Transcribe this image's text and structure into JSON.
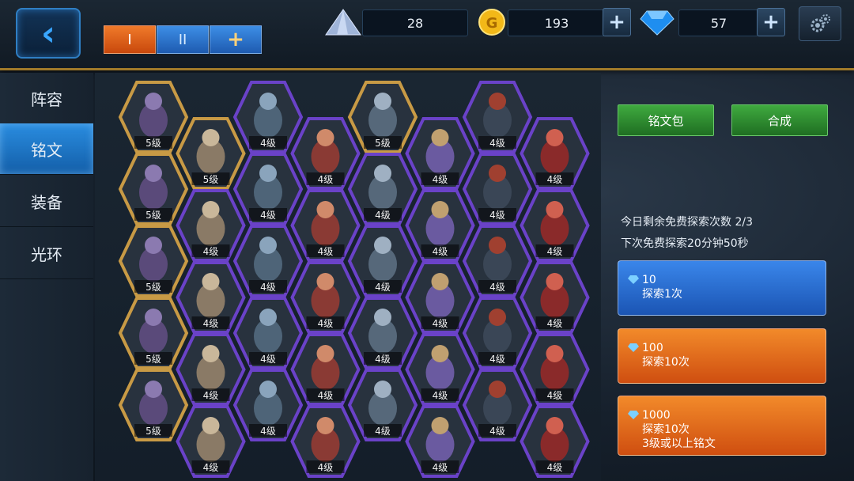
{
  "top_tabs": {
    "tab1": "I",
    "tab2": "II",
    "add": "+"
  },
  "resources": {
    "crystal": "28",
    "gold": "193",
    "diamond": "57",
    "plus": "+"
  },
  "sidebar": {
    "items": [
      {
        "label": "阵容"
      },
      {
        "label": "铭文"
      },
      {
        "label": "装备"
      },
      {
        "label": "光环"
      }
    ]
  },
  "actions": {
    "pack": "铭文包",
    "combine": "合成"
  },
  "info": {
    "free_count": "今日剩余免费探索次数  2/3",
    "next_free": "下次免费探索20分钟50秒"
  },
  "explore_options": [
    {
      "cost": "10",
      "label": "探索1次"
    },
    {
      "cost": "100",
      "label": "探索10次"
    },
    {
      "cost": "1000",
      "label": "探索10次",
      "sub": "3级或以上铭文"
    }
  ],
  "grid_columns": [
    {
      "rune": "hooded-mage",
      "level": "5级",
      "frame": "gold",
      "count": 5
    },
    {
      "rune": "winged-warrior",
      "level": [
        "5级",
        "4级",
        "4级",
        "4级",
        "4级"
      ],
      "frame": "mixed",
      "count": 5
    },
    {
      "rune": "beast-rider",
      "level": "4级",
      "frame": "purple",
      "count": 5
    },
    {
      "rune": "brawler",
      "level": "4级",
      "frame": "purple",
      "count": 5
    },
    {
      "rune": "armored-knight",
      "level": [
        "5级",
        "4级",
        "4级",
        "4级",
        "4级"
      ],
      "frame": "mixed",
      "count": 5
    },
    {
      "rune": "ninja",
      "level": "4级",
      "frame": "purple",
      "count": 5
    },
    {
      "rune": "horse-rider",
      "level": "4级",
      "frame": "purple",
      "count": 5
    },
    {
      "rune": "red-knight",
      "level": "4级",
      "frame": "purple",
      "count": 5
    }
  ],
  "colors": {
    "gold_frame": "#c89a45",
    "purple_frame": "#6a42c8",
    "accent_blue": "#2a8de0",
    "accent_orange": "#e56a1c",
    "accent_green": "#2f8f32"
  }
}
